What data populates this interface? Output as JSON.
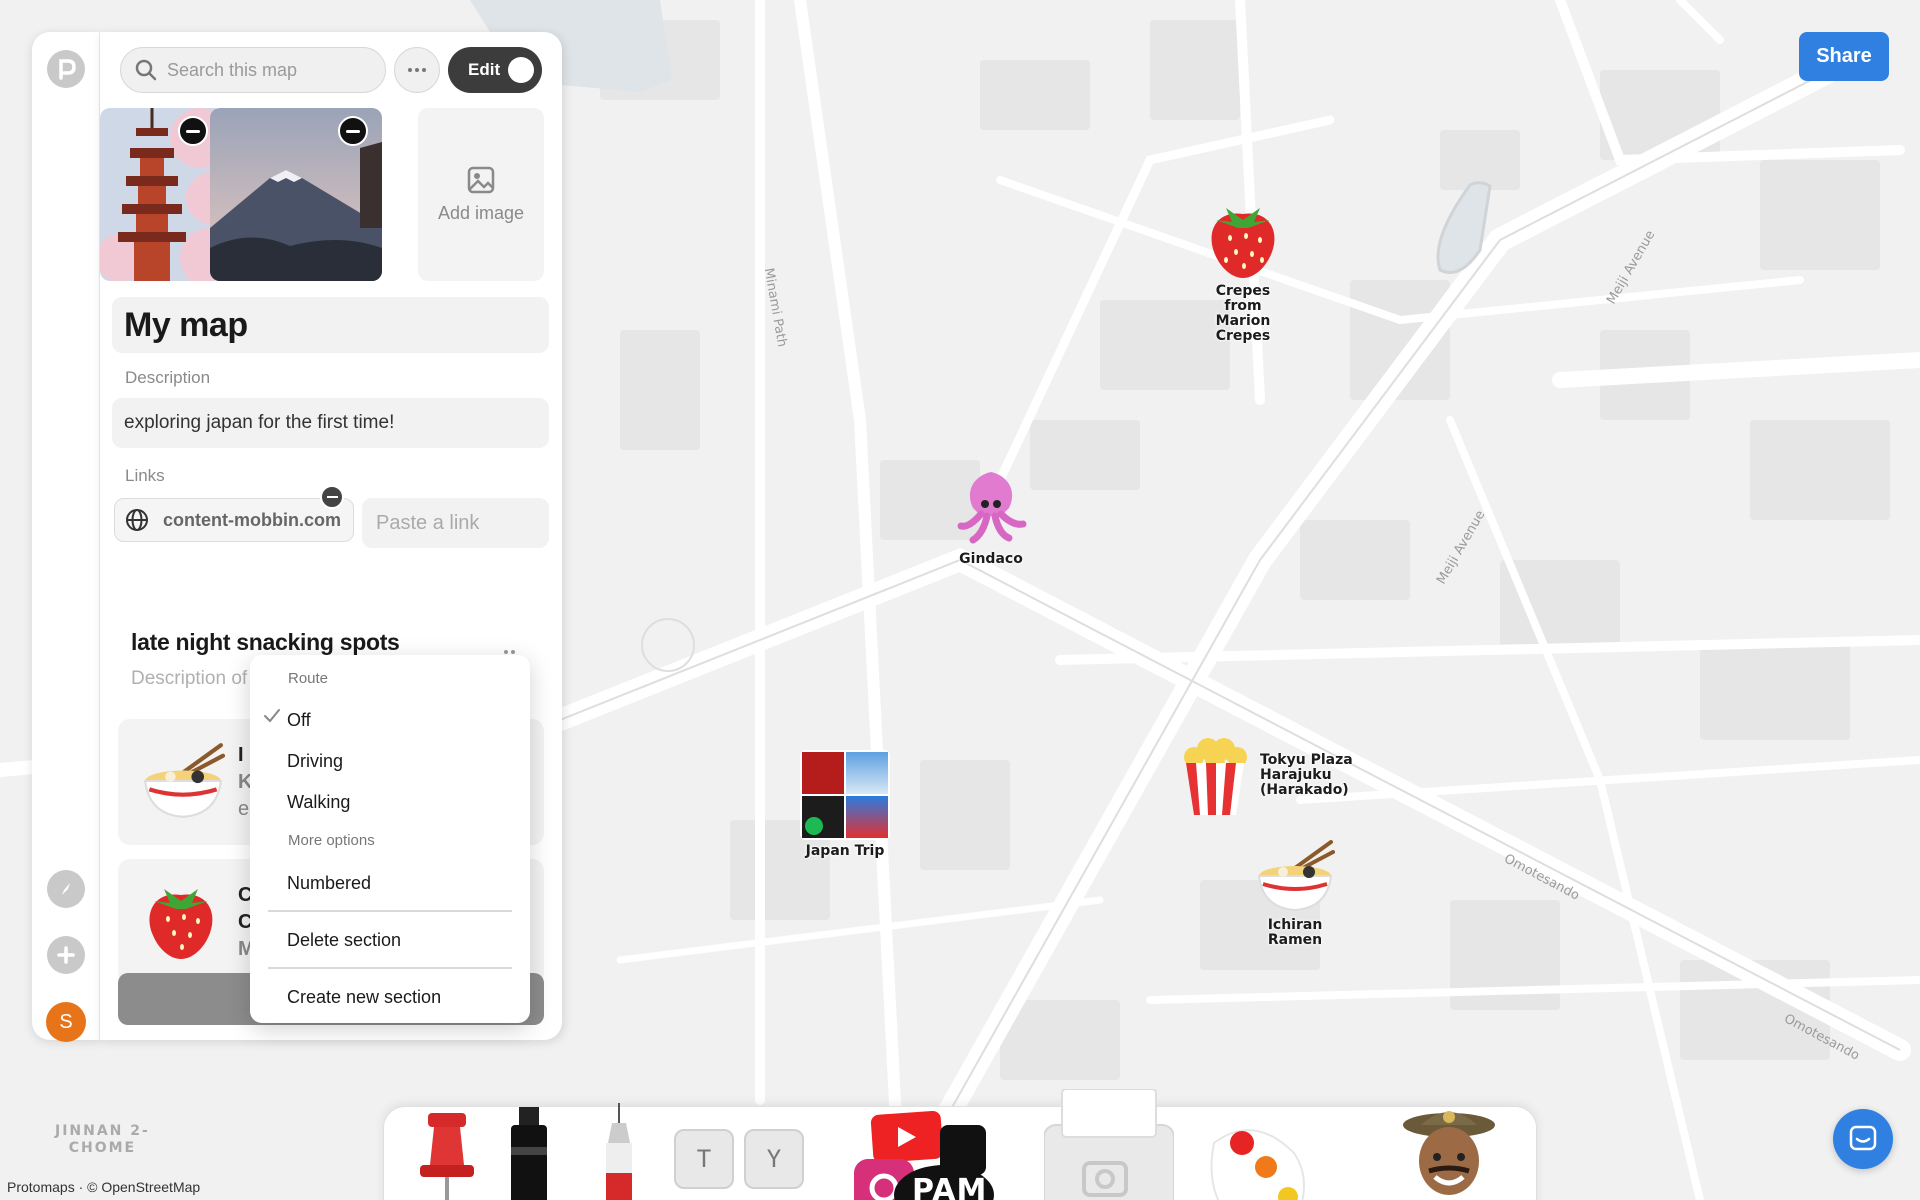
{
  "map": {
    "attribution": "Protomaps · © OpenStreetMap",
    "neighborhood": "JINNAN 2-\nCHOME",
    "street_labels": [
      "Minami Path",
      "Meiji Avenue",
      "Meiji Avenue",
      "Omotesando",
      "Omotesando"
    ],
    "pois": [
      {
        "label": "Crepes from Marion Crepes",
        "icon": "strawberry-icon"
      },
      {
        "label": "Gindaco",
        "icon": "squid-icon"
      },
      {
        "label": "Japan Trip",
        "icon": "photo-collage-icon"
      },
      {
        "label": "Tokyu Plaza Harajuku (Harakado)",
        "icon": "popcorn-icon"
      },
      {
        "label": "Ichiran Ramen",
        "icon": "ramen-icon"
      }
    ]
  },
  "header": {
    "search_placeholder": "Search this map",
    "edit_label": "Edit",
    "share_label": "Share"
  },
  "images": {
    "add_label": "Add image",
    "photos": [
      {
        "subject": "pagoda with cherry blossoms"
      },
      {
        "subject": "Mount Fuji at dusk"
      }
    ]
  },
  "details": {
    "title": "My map",
    "description_label": "Description",
    "description": "exploring japan for the first time!",
    "links_label": "Links",
    "link": "content-mobbin.com",
    "link_placeholder": "Paste a link"
  },
  "section": {
    "title": "late night snacking spots",
    "description_placeholder": "Description of this section",
    "cards": [
      {
        "letters": [
          "I",
          "K",
          "e"
        ],
        "icon": "ramen-icon"
      },
      {
        "letters": [
          "C",
          "C",
          "M"
        ],
        "icon": "strawberry-icon"
      }
    ]
  },
  "menu": {
    "route_header": "Route",
    "route_options": [
      "Off",
      "Driving",
      "Walking"
    ],
    "selected_route": "Off",
    "more_header": "More options",
    "numbered": "Numbered",
    "delete": "Delete section",
    "create": "Create new section"
  },
  "toolbar": {
    "tools": [
      "pushpin-tool",
      "marker-tool",
      "pen-tool",
      "keyboard-keys-tool",
      "social-media-tool",
      "camera-tool",
      "paint-palette-tool",
      "avatar-tool"
    ],
    "keys": [
      "T",
      "Y"
    ],
    "sticker_text": "PAM"
  },
  "user": {
    "avatar_initial": "S"
  },
  "colors": {
    "accent": "#2f80e0",
    "avatar": "#e8741a",
    "toggle": "#3c3c3c"
  }
}
